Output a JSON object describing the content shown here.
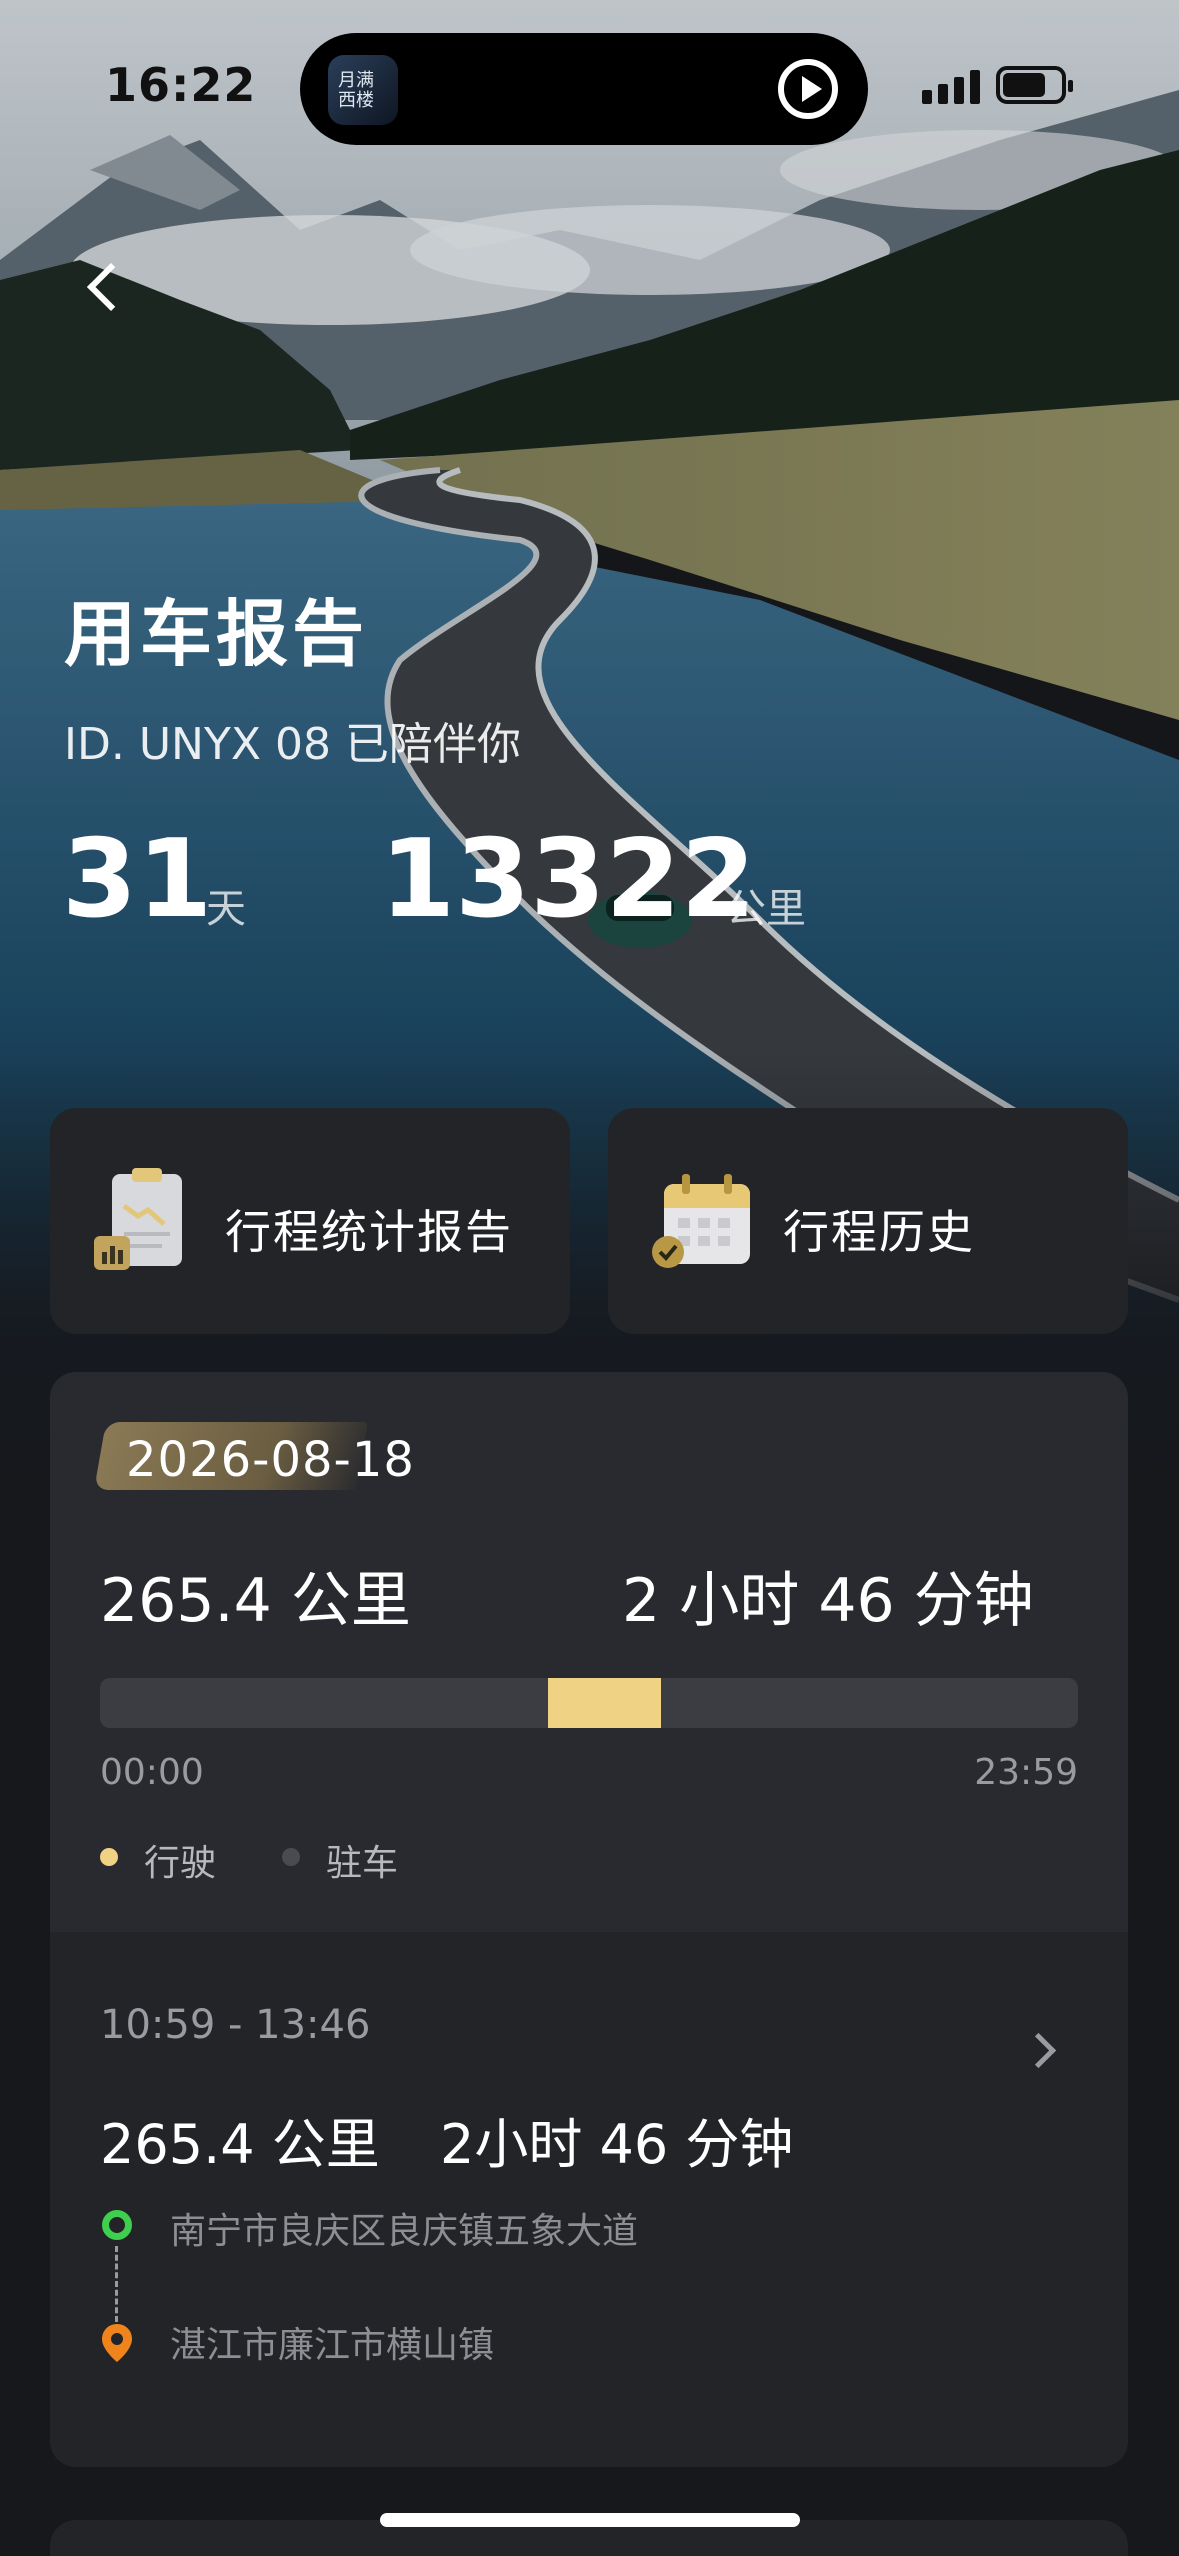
{
  "status_bar": {
    "time": "16:22",
    "island_app_text": "月满\n西楼",
    "icons": [
      "signal-icon",
      "battery-icon"
    ]
  },
  "header": {
    "back_icon": "chevron-left-icon",
    "title": "用车报告",
    "companion_text": "ID. UNYX 08 已陪伴你",
    "days": {
      "value": "31",
      "unit": "天"
    },
    "distance": {
      "value": "13322",
      "unit": "公里"
    }
  },
  "quick_cards": [
    {
      "label": "行程统计报告",
      "icon": "report-clipboard-icon"
    },
    {
      "label": "行程历史",
      "icon": "calendar-icon"
    }
  ],
  "day_record": {
    "date": "2026-08-18",
    "total_distance": "265.4 公里",
    "total_duration": "2 小时 46 分钟",
    "timeline": {
      "start_label": "00:00",
      "end_label": "23:59",
      "driving_segment_start_fraction": 0.458,
      "driving_segment_end_fraction": 0.574
    },
    "legend": [
      {
        "label": "行驶",
        "color": "#efd283"
      },
      {
        "label": "驻车",
        "color": "#4a4b50"
      }
    ]
  },
  "trip": {
    "time_range": "10:59 - 13:46",
    "distance": "265.4 公里",
    "duration": "2小时 46 分钟",
    "start_address": "南宁市良庆区良庆镇五象大道",
    "end_address": "湛江市廉江市横山镇"
  },
  "colors": {
    "accent_gold": "#efd283",
    "card_bg": "#232428",
    "page_bg": "#17181c",
    "start_pin": "#3ecf4f",
    "end_pin": "#f0841c"
  }
}
